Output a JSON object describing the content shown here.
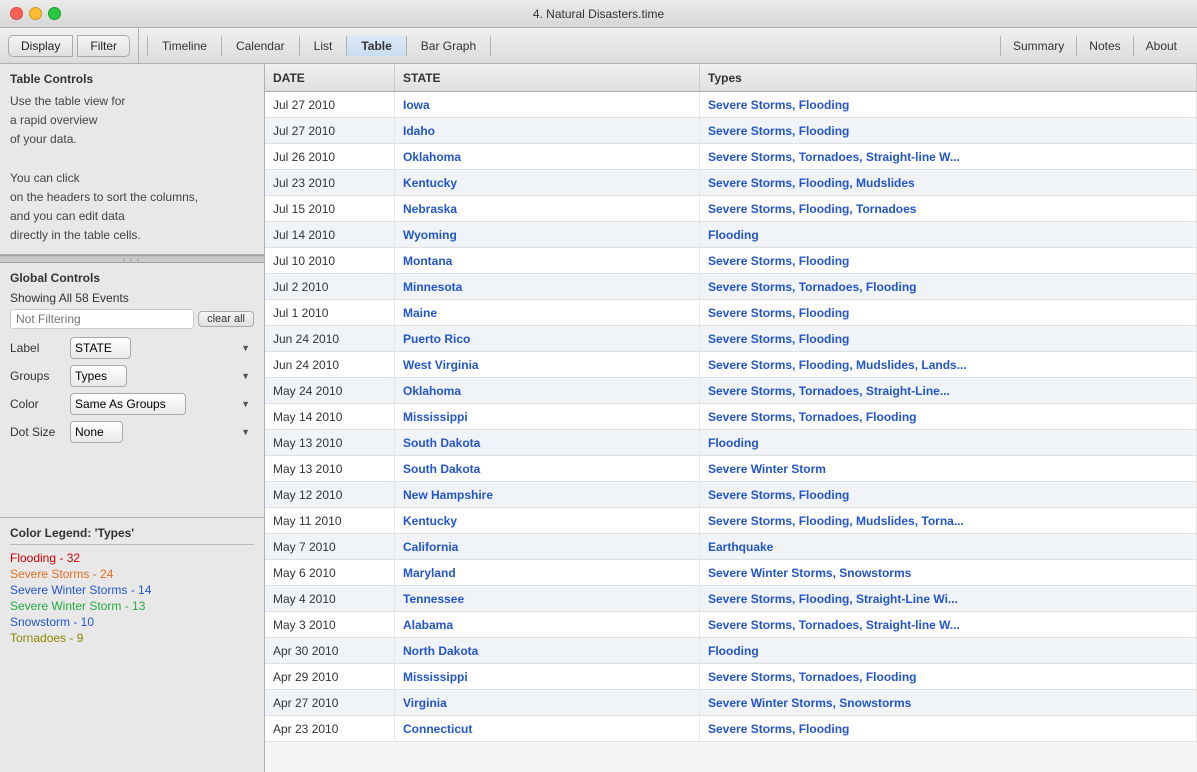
{
  "window": {
    "title": "4. Natural Disasters.time"
  },
  "toolbar": {
    "left_tabs": [
      "Display",
      "Filter"
    ],
    "center_tabs": [
      "Timeline",
      "Calendar",
      "List",
      "Table",
      "Bar Graph"
    ],
    "active_center_tab": "Table",
    "right_tabs": [
      "Summary",
      "Notes",
      "About"
    ]
  },
  "left_panel": {
    "table_controls_title": "Table Controls",
    "description_lines": [
      "Use the table view for",
      "a rapid overview",
      "of your data.",
      "",
      "You can click",
      "on the headers to sort the columns,",
      "and you can edit data",
      "directly in the table cells."
    ],
    "global_controls_title": "Global Controls",
    "showing_text": "Showing All 58 Events",
    "filter_placeholder": "Not Filtering",
    "clear_btn_label": "clear all",
    "label_control": {
      "label": "Label",
      "value": "STATE"
    },
    "groups_control": {
      "label": "Groups",
      "value": "Types"
    },
    "color_control": {
      "label": "Color",
      "value": "Same As Groups"
    },
    "dot_size_control": {
      "label": "Dot Size",
      "value": "None"
    },
    "legend_title": "Color Legend: 'Types'",
    "legend_items": [
      {
        "label": "Flooding - 32",
        "color": "#cc0000"
      },
      {
        "label": "Severe Storms - 24",
        "color": "#e07020"
      },
      {
        "label": "Severe Winter Storms - 14",
        "color": "#2255cc"
      },
      {
        "label": "Severe Winter Storm - 13",
        "color": "#22aa44"
      },
      {
        "label": "Snowstorm - 10",
        "color": "#2255cc"
      },
      {
        "label": "Tornadoes - 9",
        "color": "#888800"
      }
    ]
  },
  "table": {
    "headers": [
      "DATE",
      "STATE",
      "Types"
    ],
    "rows": [
      {
        "date": "Jul 27 2010",
        "state": "Iowa",
        "types": "Severe Storms, Flooding"
      },
      {
        "date": "Jul 27 2010",
        "state": "Idaho",
        "types": "Severe Storms, Flooding"
      },
      {
        "date": "Jul 26 2010",
        "state": "Oklahoma",
        "types": "Severe Storms, Tornadoes, Straight-line W..."
      },
      {
        "date": "Jul 23 2010",
        "state": "Kentucky",
        "types": "Severe Storms, Flooding, Mudslides"
      },
      {
        "date": "Jul 15 2010",
        "state": "Nebraska",
        "types": "Severe Storms, Flooding, Tornadoes"
      },
      {
        "date": "Jul 14 2010",
        "state": "Wyoming",
        "types": "Flooding"
      },
      {
        "date": "Jul 10 2010",
        "state": "Montana",
        "types": "Severe Storms, Flooding"
      },
      {
        "date": "Jul 2 2010",
        "state": "Minnesota",
        "types": "Severe Storms, Tornadoes, Flooding"
      },
      {
        "date": "Jul 1 2010",
        "state": "Maine",
        "types": "Severe Storms, Flooding"
      },
      {
        "date": "Jun 24 2010",
        "state": "Puerto Rico",
        "types": "Severe Storms, Flooding"
      },
      {
        "date": "Jun 24 2010",
        "state": "West Virginia",
        "types": "Severe Storms, Flooding, Mudslides, Lands..."
      },
      {
        "date": "May 24 2010",
        "state": "Oklahoma",
        "types": "Severe Storms, Tornadoes, Straight-Line..."
      },
      {
        "date": "May 14 2010",
        "state": "Mississippi",
        "types": "Severe Storms, Tornadoes, Flooding"
      },
      {
        "date": "May 13 2010",
        "state": "South Dakota",
        "types": "Flooding"
      },
      {
        "date": "May 13 2010",
        "state": "South Dakota",
        "types": "Severe Winter Storm"
      },
      {
        "date": "May 12 2010",
        "state": "New Hampshire",
        "types": "Severe Storms, Flooding"
      },
      {
        "date": "May 11 2010",
        "state": "Kentucky",
        "types": "Severe Storms, Flooding, Mudslides, Torna..."
      },
      {
        "date": "May 7 2010",
        "state": "California",
        "types": "Earthquake"
      },
      {
        "date": "May 6 2010",
        "state": "Maryland",
        "types": "Severe Winter Storms, Snowstorms"
      },
      {
        "date": "May 4 2010",
        "state": "Tennessee",
        "types": "Severe Storms, Flooding, Straight-Line Wi..."
      },
      {
        "date": "May 3 2010",
        "state": "Alabama",
        "types": "Severe Storms, Tornadoes, Straight-line W..."
      },
      {
        "date": "Apr 30 2010",
        "state": "North Dakota",
        "types": "Flooding"
      },
      {
        "date": "Apr 29 2010",
        "state": "Mississippi",
        "types": "Severe Storms, Tornadoes, Flooding"
      },
      {
        "date": "Apr 27 2010",
        "state": "Virginia",
        "types": "Severe Winter Storms, Snowstorms"
      },
      {
        "date": "Apr 23 2010",
        "state": "Connecticut",
        "types": "Severe Storms, Flooding"
      }
    ]
  }
}
